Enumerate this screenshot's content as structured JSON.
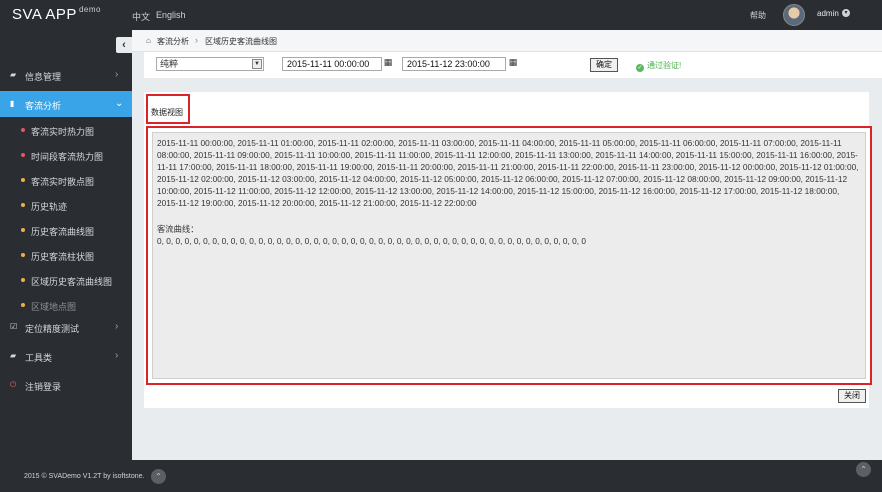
{
  "header": {
    "logo": "SVA APP",
    "logo_suffix": "demo",
    "lang_cn": "中文",
    "lang_en": "English",
    "help": "帮助",
    "user": "admin"
  },
  "sidebar": {
    "collapse_icon": "‹",
    "items": [
      {
        "label": "信息管理",
        "icon": "book-icon"
      },
      {
        "label": "客流分析",
        "icon": "bar-chart-icon",
        "active": true
      },
      {
        "label": "定位精度测试",
        "icon": "check-square-icon"
      },
      {
        "label": "工具类",
        "icon": "folder-icon"
      },
      {
        "label": "注销登录",
        "icon": "power-icon"
      }
    ],
    "sub_items": [
      {
        "label": "客流实时热力图",
        "dot": "#e05a5a"
      },
      {
        "label": "时间段客流热力图",
        "dot": "#e05a5a"
      },
      {
        "label": "客流实时散点图",
        "dot": "#f0ad4e"
      },
      {
        "label": "历史轨迹",
        "dot": "#f0ad4e"
      },
      {
        "label": "历史客流曲线图",
        "dot": "#f0ad4e"
      },
      {
        "label": "历史客流柱状图",
        "dot": "#f0ad4e"
      },
      {
        "label": "区域历史客流曲线图",
        "dot": "#f0ad4e"
      },
      {
        "label": "区域地点图",
        "dot": "#f0ad4e"
      }
    ]
  },
  "breadcrumb": {
    "level1": "客流分析",
    "level2": "区域历史客流曲线图"
  },
  "filters": {
    "select_value": "纯粹",
    "start_time": "2015-11-11 00:00:00",
    "end_time": "2015-11-12 23:00:00",
    "confirm_label": "确定",
    "verify_text": "通过验证!"
  },
  "panel": {
    "tab_label": "数据视图",
    "times_text": "2015-11-11 00:00:00, 2015-11-11 01:00:00, 2015-11-11 02:00:00, 2015-11-11 03:00:00, 2015-11-11 04:00:00, 2015-11-11 05:00:00, 2015-11-11 06:00:00, 2015-11-11 07:00:00, 2015-11-11 08:00:00, 2015-11-11 09:00:00, 2015-11-11 10:00:00, 2015-11-11 11:00:00, 2015-11-11 12:00:00, 2015-11-11 13:00:00, 2015-11-11 14:00:00, 2015-11-11 15:00:00, 2015-11-11 16:00:00, 2015-11-11 17:00:00, 2015-11-11 18:00:00, 2015-11-11 19:00:00, 2015-11-11 20:00:00, 2015-11-11 21:00:00, 2015-11-11 22:00:00, 2015-11-11 23:00:00, 2015-11-12 00:00:00, 2015-11-12 01:00:00, 2015-11-12 02:00:00, 2015-11-12 03:00:00, 2015-11-12 04:00:00, 2015-11-12 05:00:00, 2015-11-12 06:00:00, 2015-11-12 07:00:00, 2015-11-12 08:00:00, 2015-11-12 09:00:00, 2015-11-12 10:00:00, 2015-11-12 11:00:00, 2015-11-12 12:00:00, 2015-11-12 13:00:00, 2015-11-12 14:00:00, 2015-11-12 15:00:00, 2015-11-12 16:00:00, 2015-11-12 17:00:00, 2015-11-12 18:00:00, 2015-11-12 19:00:00, 2015-11-12 20:00:00, 2015-11-12 21:00:00, 2015-11-12 22:00:00",
    "curve_label": "客流曲线：",
    "values_text": "0, 0, 0, 0, 0, 0, 0, 0, 0, 0, 0, 0, 0, 0, 0, 0, 0, 0, 0, 0, 0, 0, 0, 0, 0, 0, 0, 0, 0, 0, 0, 0, 0, 0, 0, 0, 0, 0, 0, 0, 0, 0, 0, 0, 0, 0, 0",
    "close_label": "关闭"
  },
  "footer": {
    "text": "2015 © SVADemo V1.2T by isoftstone."
  },
  "colors": {
    "accent": "#3aa4e9",
    "highlight_border": "#d9252a",
    "verify_green": "#4cae4c"
  }
}
